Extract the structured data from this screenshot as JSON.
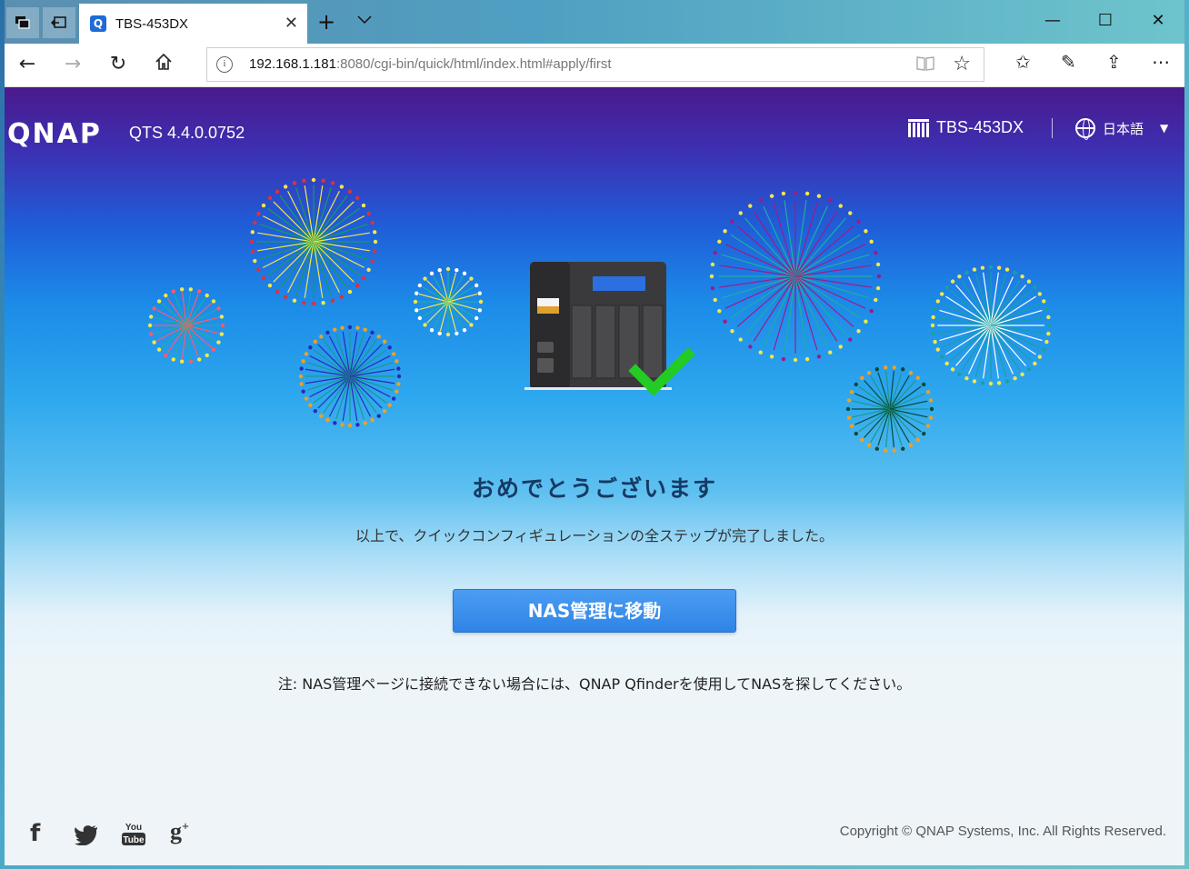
{
  "browser": {
    "tab_title": "TBS-453DX",
    "favicon_letter": "Q",
    "url_host": "192.168.1.181",
    "url_rest": ":8080/cgi-bin/quick/html/index.html#apply/first"
  },
  "header": {
    "logo": "QNAP",
    "version": "QTS 4.4.0.0752",
    "model": "TBS-453DX",
    "language": "日本語"
  },
  "main": {
    "title": "おめでとうございます",
    "description": "以上で、クイックコンフィギュレーションの全ステップが完了しました。",
    "button_label": "NAS管理に移動",
    "note": "注: NAS管理ページに接続できない場合には、QNAP Qfinderを使用してNASを探してください。"
  },
  "footer": {
    "social": [
      {
        "name": "facebook-icon",
        "glyph": "f"
      },
      {
        "name": "twitter-icon",
        "glyph": "🐦"
      },
      {
        "name": "youtube-icon",
        "glyph": "You Tube"
      },
      {
        "name": "google-plus-icon",
        "glyph": "g+"
      }
    ],
    "copyright": "Copyright © QNAP Systems, Inc. All Rights Reserved."
  },
  "colors": {
    "accent": "#2f84e6",
    "check": "#22cc22",
    "title_text": "#153a63"
  }
}
